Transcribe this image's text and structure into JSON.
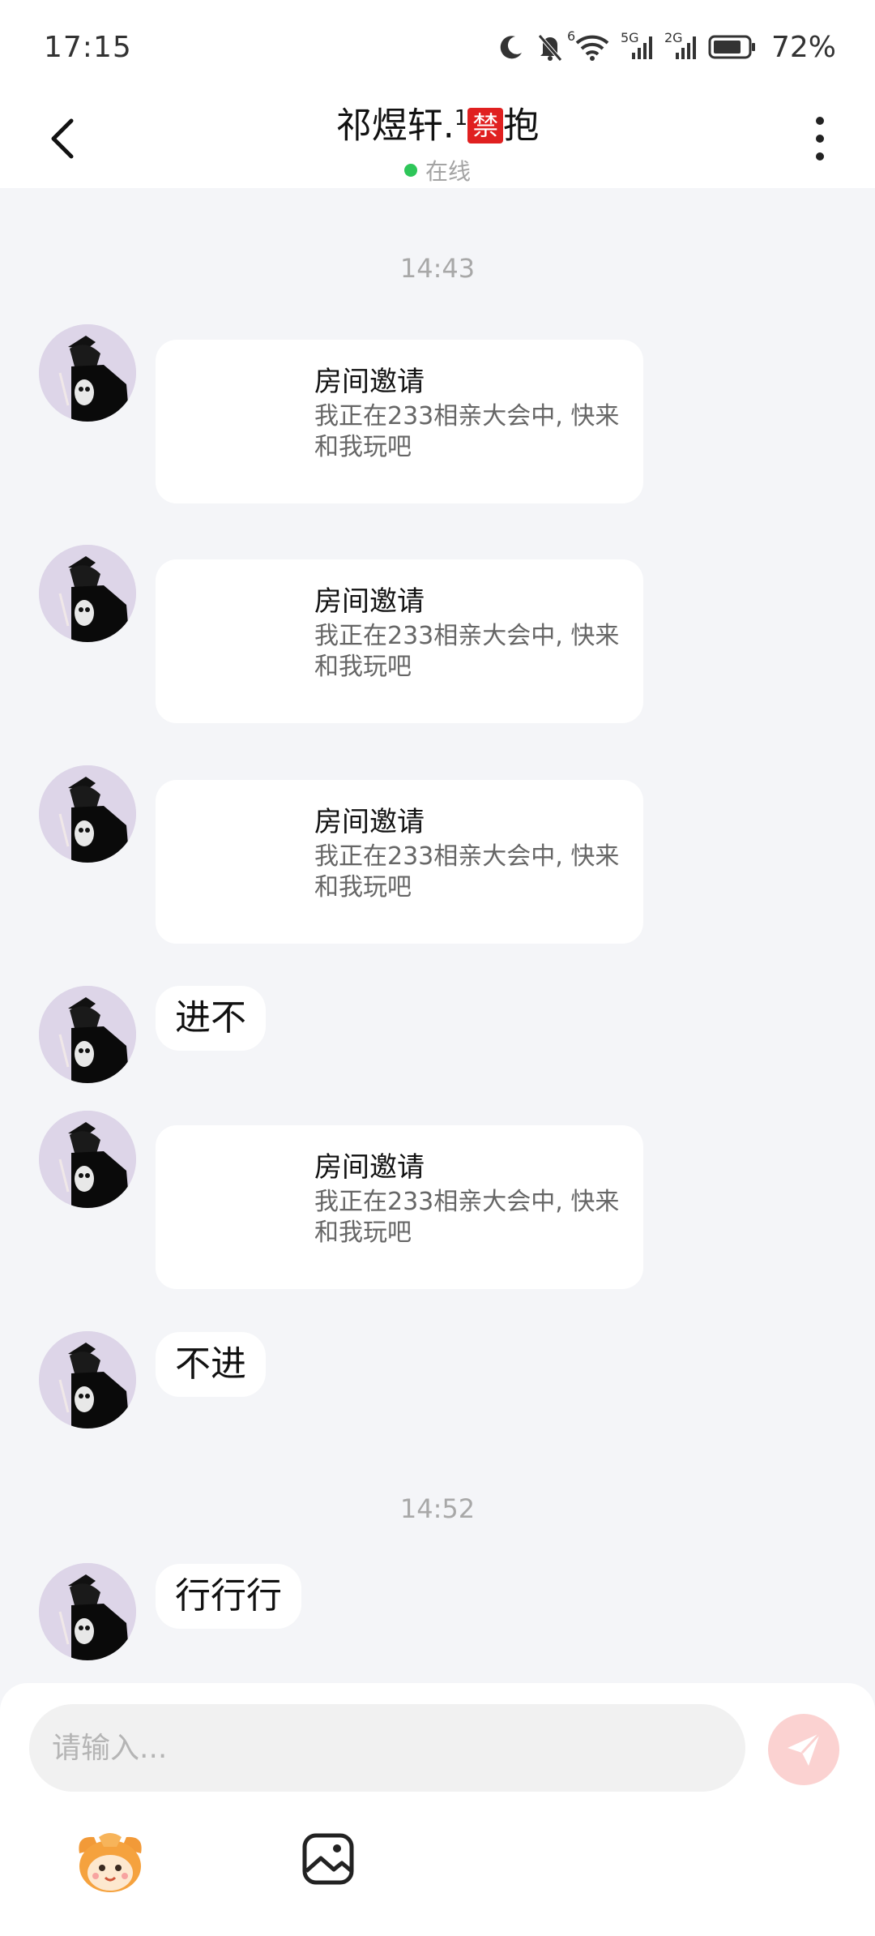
{
  "status_bar": {
    "time": "17:15",
    "signal_labels": [
      "6",
      "5G",
      "2G"
    ],
    "battery": "72%"
  },
  "header": {
    "title_prefix": "祁煜轩.",
    "title_superscript": "1",
    "title_ban_badge": "禁",
    "title_suffix": "抱",
    "status": "在线",
    "online_color": "#2ec659"
  },
  "chat": {
    "timestamps": [
      "14:43",
      "14:52"
    ],
    "messages": [
      {
        "type": "card",
        "title": "房间邀请",
        "desc": "我正在233相亲大会中, 快来和我玩吧"
      },
      {
        "type": "card",
        "title": "房间邀请",
        "desc": "我正在233相亲大会中, 快来和我玩吧"
      },
      {
        "type": "card",
        "title": "房间邀请",
        "desc": "我正在233相亲大会中, 快来和我玩吧"
      },
      {
        "type": "text",
        "text": "进不"
      },
      {
        "type": "card",
        "title": "房间邀请",
        "desc": "我正在233相亲大会中, 快来和我玩吧"
      },
      {
        "type": "text",
        "text": "不进"
      },
      {
        "type": "text",
        "text": "行行行"
      }
    ]
  },
  "input": {
    "placeholder": "请输入..."
  },
  "icons": {
    "back": "back-arrow-icon",
    "more": "more-vertical-icon",
    "send": "send-plane-icon",
    "emoji": "mascot-emoji-icon",
    "image": "image-gallery-icon"
  },
  "colors": {
    "background": "#f4f5f8",
    "send_button": "#fbd2d1",
    "ban_badge": "#e02020"
  }
}
